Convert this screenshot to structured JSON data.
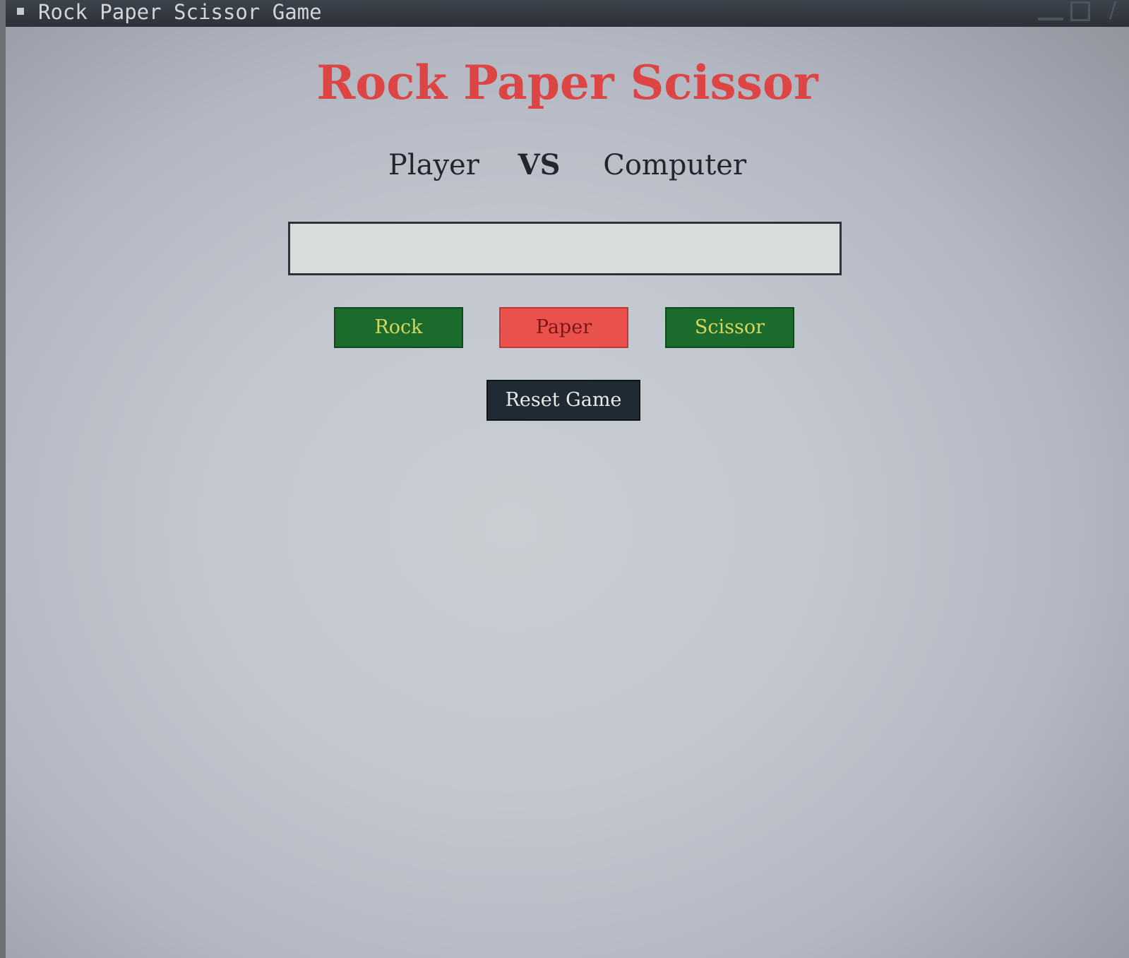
{
  "window": {
    "title": "Rock Paper Scissor Game",
    "close_glyph": "/"
  },
  "main": {
    "heading": "Rock Paper Scissor",
    "matchup": {
      "left": "Player",
      "middle": "VS",
      "right": "Computer"
    },
    "result_text": ""
  },
  "choices": [
    {
      "label": "Rock",
      "bg": "#1a6b2c",
      "fg": "#d7d65c"
    },
    {
      "label": "Paper",
      "bg": "#e9524c",
      "fg": "#7a1815"
    },
    {
      "label": "Scissor",
      "bg": "#1a6b2c",
      "fg": "#d7d65c"
    }
  ],
  "reset": {
    "label": "Reset Game",
    "bg": "#1f2a33",
    "fg": "#e9eaec"
  },
  "colors": {
    "heading": "#dd4545",
    "titlebar": "#2d3239"
  },
  "icons": {
    "title": "window-menu-icon",
    "minimize": "minimize-icon",
    "maximize": "maximize-icon",
    "close": "close-icon"
  }
}
